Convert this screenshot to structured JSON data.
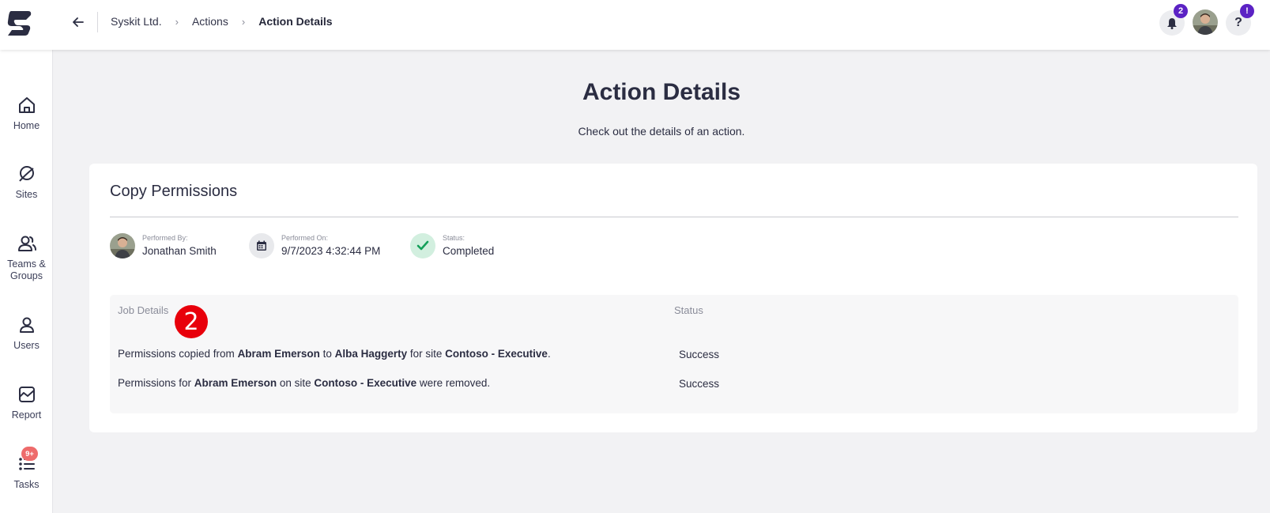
{
  "header": {
    "breadcrumb": [
      "Syskit Ltd.",
      "Actions",
      "Action Details"
    ],
    "notifications_count": "2",
    "help_badge": "!"
  },
  "sidebar": {
    "items": [
      {
        "label": "Home",
        "icon": "home-icon"
      },
      {
        "label": "Sites",
        "icon": "sites-icon"
      },
      {
        "label": "Teams & Groups",
        "icon": "teams-icon"
      },
      {
        "label": "Users",
        "icon": "user-icon"
      },
      {
        "label": "Report",
        "icon": "report-icon"
      },
      {
        "label": "Tasks",
        "icon": "tasks-icon",
        "badge": "9+"
      }
    ]
  },
  "page": {
    "title": "Action Details",
    "subtitle": "Check out the details of an action."
  },
  "card": {
    "title": "Copy Permissions",
    "performed_by_label": "Performed By:",
    "performed_by": "Jonathan Smith",
    "performed_on_label": "Performed On:",
    "performed_on": "9/7/2023 4:32:44 PM",
    "status_label": "Status:",
    "status": "Completed"
  },
  "jobs": {
    "col_details": "Job Details",
    "col_status": "Status",
    "rows": [
      {
        "parts": [
          "Permissions copied from ",
          "Abram Emerson",
          " to ",
          "Alba Haggerty",
          " for site ",
          "Contoso - Executive",
          "."
        ],
        "status": "Success"
      },
      {
        "parts": [
          "Permissions for ",
          "Abram Emerson",
          " on site ",
          "Contoso - Executive",
          " were removed."
        ],
        "status": "Success"
      }
    ]
  },
  "annotation": {
    "step": "2"
  },
  "colors": {
    "accent": "#5b22c4",
    "badge_red": "#ee6b6b",
    "success_green": "#15a05a",
    "marker_red": "#e8000b"
  }
}
